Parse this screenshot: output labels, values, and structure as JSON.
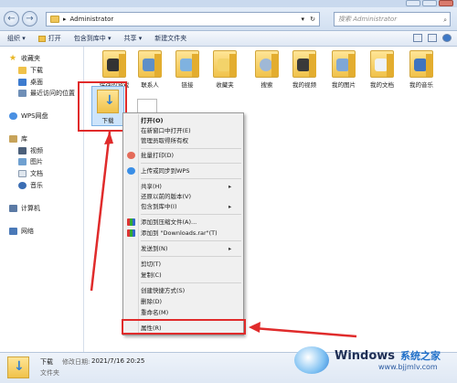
{
  "colors": {
    "accent_red": "#e02b2b",
    "selection": "#cde4fb",
    "folder": "#f0c24a",
    "brand_blue": "#2f7fd6"
  },
  "address": {
    "path_sep": "▸",
    "path": "Administrator",
    "dropdown": "▾",
    "refresh": "↻"
  },
  "search": {
    "placeholder": "搜索 Administrator",
    "icon": "search-icon"
  },
  "nav": {
    "back": "←",
    "forward": "→"
  },
  "toolbar": {
    "organize": "组织 ▾",
    "open": "打开",
    "include_in_library": "包含到库中 ▾",
    "share": "共享 ▾",
    "new_folder": "新建文件夹"
  },
  "sidebar": {
    "favorites": "收藏夹",
    "downloads": "下载",
    "desktop": "桌面",
    "recent": "最近访问的位置",
    "wps": "WPS网盘",
    "libraries": "库",
    "videos": "视频",
    "pictures": "图片",
    "documents": "文档",
    "music": "音乐",
    "computer": "计算机",
    "network": "网络"
  },
  "folders": [
    {
      "label": "保存的游戏"
    },
    {
      "label": "联系人"
    },
    {
      "label": "链接"
    },
    {
      "label": "收藏夹"
    },
    {
      "label": "搜索"
    },
    {
      "label": "我的视频"
    },
    {
      "label": "我的图片"
    },
    {
      "label": "我的文档"
    },
    {
      "label": "我的音乐"
    }
  ],
  "selected_folder": {
    "label": "下载"
  },
  "context_menu": {
    "open": "打开(O)",
    "open_new_window": "在新窗口中打开(E)",
    "admin_ownership": "管理员取得所有权",
    "batch_print": "批量打印(D)",
    "upload_wps": "上传或同步到WPS",
    "share": "共享(H)",
    "restore_prev": "还原以前的版本(V)",
    "include_library": "包含到库中(I)",
    "add_archive": "添加到压缩文件(A)...",
    "add_rar": "添加到 \"Downloads.rar\"(T)",
    "send_to": "发送到(N)",
    "cut": "剪切(T)",
    "copy": "复制(C)",
    "create_shortcut": "创建快捷方式(S)",
    "delete": "删除(D)",
    "rename": "重命名(M)",
    "properties": "属性(R)",
    "submenu_arrow": "▸"
  },
  "status": {
    "name": "下载",
    "modified_label": "修改日期:",
    "modified_value": "2021/7/16 20:25",
    "type": "文件夹"
  },
  "watermark": {
    "brand": "Windows",
    "site_cn": "系统之家",
    "site_url": "www.bjjmlv.com"
  }
}
